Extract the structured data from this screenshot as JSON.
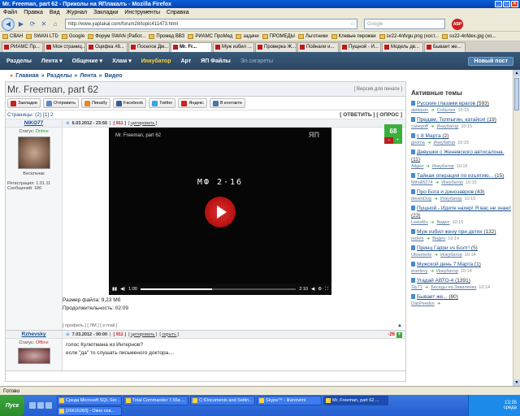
{
  "window": {
    "title": "Mr. Freeman, part 62 - Приколы на ЯПлакалъ - Mozilla Firefox"
  },
  "menu": [
    "Файл",
    "Правка",
    "Вид",
    "Журнал",
    "Закладки",
    "Инструменты",
    "Справка"
  ],
  "nav": {
    "url": "http://www.yaplakal.com/forum28/topic411473.html",
    "search_placeholder": "Google",
    "addon": "ABP"
  },
  "bookmarks": [
    "СВАН",
    "SWAN LTD",
    "Google",
    "Форум SWAN (Работ...",
    "Промед ВВЗ",
    "РИАМС ПроМед",
    "задачи",
    "ПРОМЕДЫ",
    "Льготники",
    "Клевые пирожки",
    "sv22-4nfvgu.png (хост...",
    "sv22-4nfdex.jpg (хо..."
  ],
  "tabs": [
    {
      "label": "РИАМС Пр...",
      "active": false
    },
    {
      "label": "Моя страниц...",
      "active": false
    },
    {
      "label": "Оцифка #8...",
      "active": false
    },
    {
      "label": "Поселок Дм...",
      "active": false
    },
    {
      "label": "Mr. Fr...",
      "active": true
    },
    {
      "label": "Муж избил ...",
      "active": false
    },
    {
      "label": "Проверка Ж...",
      "active": false
    },
    {
      "label": "Пойнали и...",
      "active": false
    },
    {
      "label": "Пущной - И...",
      "active": false
    },
    {
      "label": "Модель дв...",
      "active": false
    },
    {
      "label": "Бывает же...",
      "active": false
    }
  ],
  "site_nav": {
    "sections": "Разделы",
    "items": [
      "Лента ▾",
      "Общение ▾",
      "Хлам ▾"
    ],
    "highlight": "Инкубатор",
    "items2": [
      "Арт",
      "ЯП Файлы"
    ],
    "muted": "Эл.сигареты",
    "new_post": "Новый пост"
  },
  "breadcrumb": [
    "Главная",
    "Разделы",
    "Лента",
    "Видео"
  ],
  "topic": {
    "title": "Mr. Freeman, part 62",
    "print_version": "[ Версия для печати ]"
  },
  "share": [
    "Закладки",
    "Отправить",
    "Пинабу",
    "Facebook",
    "Twitter",
    "Яндекс",
    "В контакте"
  ],
  "pager": {
    "label": "Страницы:",
    "pages": "(2) [1] 2",
    "actions": "[ ОТВЕТИТЬ ] [ ОПРОС ]"
  },
  "post1": {
    "author": "NIKO77",
    "status_label": "Статус:",
    "status": "Online",
    "rank": "Весельчак",
    "registered": "Регистрация: 1.01.11",
    "messages": "Сообщений: 186",
    "date": "6.03.2012 - 23:56",
    "number": "[ 911 ]",
    "quote": "[ цитировать ]",
    "video": {
      "title": "Mr. Freeman, part 62",
      "logo": "ЯП",
      "center_text": "МФ 2·16",
      "time_current": "1:00",
      "time_total": "2:10",
      "progress": 0.46
    },
    "rating": "68",
    "file_size": "Размер файла: 9,23 Мб",
    "duration": "Продолжительность: 02:09",
    "actions": "[ профиль ] [ ЛМ ] [ e-mail ]"
  },
  "post2": {
    "author": "Rzhevsky",
    "status_label": "Статус:",
    "status": "Offline",
    "date": "7.03.2012 - 00:00",
    "number": "[ 911 ]",
    "quote": "[ цитировать ]",
    "hide": "[ скрыть ]",
    "rating": "-26",
    "text": [
      "голос Кулютмана из Интернов?",
      "если \"да\" то слушать письменого доктора...."
    ]
  },
  "sidebar": {
    "title": "Активные темы",
    "threads": [
      {
        "title": "Русские глазами врагов",
        "count": "(593)",
        "user": "alebaum",
        "section": "События",
        "time": "10:15"
      },
      {
        "title": "Предам, Толпыгин, катайся!",
        "count": "(19)",
        "user": "саперoff",
        "section": "Инкубатор",
        "time": "10:15"
      },
      {
        "title": "с 8 Марта",
        "count": "(2)",
        "user": "gnoma",
        "section": "Инкубатор",
        "time": "10:15"
      },
      {
        "title": "Девушки с Женевского автосалона.",
        "count": "(11)",
        "user": "Allgeo",
        "section": "Инкубатор",
        "time": "10:15"
      },
      {
        "title": "Тайная операция по изъятию...",
        "count": "(15)",
        "user": "Mihail5274",
        "section": "Инкубатор",
        "time": "10:15"
      },
      {
        "title": "Про Бога и динозавров",
        "count": "(43)",
        "user": "drivenDog",
        "section": "Инкубатор",
        "time": "10:15"
      },
      {
        "title": "Пущной - Идите нахер! Я вас не знаю!",
        "count": "(23)",
        "user": "LeeteRu",
        "section": "Видео",
        "time": "10:15"
      },
      {
        "title": "Муж избил жену при детях",
        "count": "(132)",
        "user": "redom",
        "section": "Видео",
        "time": "10:14"
      },
      {
        "title": "Принц Гарри vs Болт!",
        "count": "(5)",
        "user": "Ultramerle",
        "section": "Инкубатор",
        "time": "10:14"
      },
      {
        "title": "Мужской день 7 Марта",
        "count": "(1)",
        "user": "everlevy",
        "section": "Инкубатор",
        "time": "10:14"
      },
      {
        "title": "Угадай АВТО-4",
        "count": "(1391)",
        "user": "Sly71",
        "section": "Беседы на Завалинка",
        "time": "10:14"
      },
      {
        "title": "Бывает же...",
        "count": "(80)",
        "user": "DanPeedvn",
        "section": "",
        "time": ""
      }
    ]
  },
  "statusbar": "Готово",
  "taskbar": {
    "start": "Пуск",
    "tasks_row1": [
      "Среда Microsoft SQL Ser...",
      "Total Commander 7.55a ...",
      "C:\\Documents and Settin...",
      "Skype™ - lilvinovimi",
      "Mr. Freeman, part 62 ..."
    ],
    "tasks_row2": [
      "[26615283] - Окно сов..."
    ],
    "time": "13:35",
    "day": "среда"
  }
}
